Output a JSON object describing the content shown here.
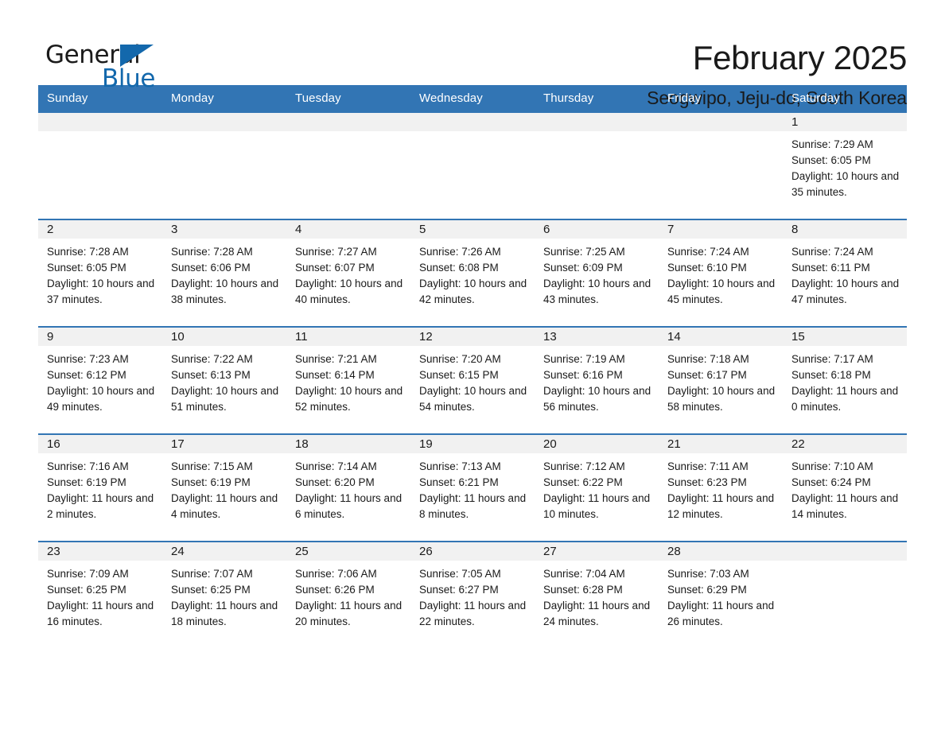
{
  "brand": {
    "name_part1": "General",
    "name_part2": "Blue",
    "triangle_color": "#1368ac",
    "accent_color": "#3275b4"
  },
  "header": {
    "title": "February 2025",
    "subtitle": "Seogwipo, Jeju-do, South Korea"
  },
  "weekday_headers": [
    "Sunday",
    "Monday",
    "Tuesday",
    "Wednesday",
    "Thursday",
    "Friday",
    "Saturday"
  ],
  "weeks": [
    [
      {
        "day": "",
        "sunrise": "",
        "sunset": "",
        "daylight": ""
      },
      {
        "day": "",
        "sunrise": "",
        "sunset": "",
        "daylight": ""
      },
      {
        "day": "",
        "sunrise": "",
        "sunset": "",
        "daylight": ""
      },
      {
        "day": "",
        "sunrise": "",
        "sunset": "",
        "daylight": ""
      },
      {
        "day": "",
        "sunrise": "",
        "sunset": "",
        "daylight": ""
      },
      {
        "day": "",
        "sunrise": "",
        "sunset": "",
        "daylight": ""
      },
      {
        "day": "1",
        "sunrise": "Sunrise: 7:29 AM",
        "sunset": "Sunset: 6:05 PM",
        "daylight": "Daylight: 10 hours and 35 minutes."
      }
    ],
    [
      {
        "day": "2",
        "sunrise": "Sunrise: 7:28 AM",
        "sunset": "Sunset: 6:05 PM",
        "daylight": "Daylight: 10 hours and 37 minutes."
      },
      {
        "day": "3",
        "sunrise": "Sunrise: 7:28 AM",
        "sunset": "Sunset: 6:06 PM",
        "daylight": "Daylight: 10 hours and 38 minutes."
      },
      {
        "day": "4",
        "sunrise": "Sunrise: 7:27 AM",
        "sunset": "Sunset: 6:07 PM",
        "daylight": "Daylight: 10 hours and 40 minutes."
      },
      {
        "day": "5",
        "sunrise": "Sunrise: 7:26 AM",
        "sunset": "Sunset: 6:08 PM",
        "daylight": "Daylight: 10 hours and 42 minutes."
      },
      {
        "day": "6",
        "sunrise": "Sunrise: 7:25 AM",
        "sunset": "Sunset: 6:09 PM",
        "daylight": "Daylight: 10 hours and 43 minutes."
      },
      {
        "day": "7",
        "sunrise": "Sunrise: 7:24 AM",
        "sunset": "Sunset: 6:10 PM",
        "daylight": "Daylight: 10 hours and 45 minutes."
      },
      {
        "day": "8",
        "sunrise": "Sunrise: 7:24 AM",
        "sunset": "Sunset: 6:11 PM",
        "daylight": "Daylight: 10 hours and 47 minutes."
      }
    ],
    [
      {
        "day": "9",
        "sunrise": "Sunrise: 7:23 AM",
        "sunset": "Sunset: 6:12 PM",
        "daylight": "Daylight: 10 hours and 49 minutes."
      },
      {
        "day": "10",
        "sunrise": "Sunrise: 7:22 AM",
        "sunset": "Sunset: 6:13 PM",
        "daylight": "Daylight: 10 hours and 51 minutes."
      },
      {
        "day": "11",
        "sunrise": "Sunrise: 7:21 AM",
        "sunset": "Sunset: 6:14 PM",
        "daylight": "Daylight: 10 hours and 52 minutes."
      },
      {
        "day": "12",
        "sunrise": "Sunrise: 7:20 AM",
        "sunset": "Sunset: 6:15 PM",
        "daylight": "Daylight: 10 hours and 54 minutes."
      },
      {
        "day": "13",
        "sunrise": "Sunrise: 7:19 AM",
        "sunset": "Sunset: 6:16 PM",
        "daylight": "Daylight: 10 hours and 56 minutes."
      },
      {
        "day": "14",
        "sunrise": "Sunrise: 7:18 AM",
        "sunset": "Sunset: 6:17 PM",
        "daylight": "Daylight: 10 hours and 58 minutes."
      },
      {
        "day": "15",
        "sunrise": "Sunrise: 7:17 AM",
        "sunset": "Sunset: 6:18 PM",
        "daylight": "Daylight: 11 hours and 0 minutes."
      }
    ],
    [
      {
        "day": "16",
        "sunrise": "Sunrise: 7:16 AM",
        "sunset": "Sunset: 6:19 PM",
        "daylight": "Daylight: 11 hours and 2 minutes."
      },
      {
        "day": "17",
        "sunrise": "Sunrise: 7:15 AM",
        "sunset": "Sunset: 6:19 PM",
        "daylight": "Daylight: 11 hours and 4 minutes."
      },
      {
        "day": "18",
        "sunrise": "Sunrise: 7:14 AM",
        "sunset": "Sunset: 6:20 PM",
        "daylight": "Daylight: 11 hours and 6 minutes."
      },
      {
        "day": "19",
        "sunrise": "Sunrise: 7:13 AM",
        "sunset": "Sunset: 6:21 PM",
        "daylight": "Daylight: 11 hours and 8 minutes."
      },
      {
        "day": "20",
        "sunrise": "Sunrise: 7:12 AM",
        "sunset": "Sunset: 6:22 PM",
        "daylight": "Daylight: 11 hours and 10 minutes."
      },
      {
        "day": "21",
        "sunrise": "Sunrise: 7:11 AM",
        "sunset": "Sunset: 6:23 PM",
        "daylight": "Daylight: 11 hours and 12 minutes."
      },
      {
        "day": "22",
        "sunrise": "Sunrise: 7:10 AM",
        "sunset": "Sunset: 6:24 PM",
        "daylight": "Daylight: 11 hours and 14 minutes."
      }
    ],
    [
      {
        "day": "23",
        "sunrise": "Sunrise: 7:09 AM",
        "sunset": "Sunset: 6:25 PM",
        "daylight": "Daylight: 11 hours and 16 minutes."
      },
      {
        "day": "24",
        "sunrise": "Sunrise: 7:07 AM",
        "sunset": "Sunset: 6:25 PM",
        "daylight": "Daylight: 11 hours and 18 minutes."
      },
      {
        "day": "25",
        "sunrise": "Sunrise: 7:06 AM",
        "sunset": "Sunset: 6:26 PM",
        "daylight": "Daylight: 11 hours and 20 minutes."
      },
      {
        "day": "26",
        "sunrise": "Sunrise: 7:05 AM",
        "sunset": "Sunset: 6:27 PM",
        "daylight": "Daylight: 11 hours and 22 minutes."
      },
      {
        "day": "27",
        "sunrise": "Sunrise: 7:04 AM",
        "sunset": "Sunset: 6:28 PM",
        "daylight": "Daylight: 11 hours and 24 minutes."
      },
      {
        "day": "28",
        "sunrise": "Sunrise: 7:03 AM",
        "sunset": "Sunset: 6:29 PM",
        "daylight": "Daylight: 11 hours and 26 minutes."
      },
      {
        "day": "",
        "sunrise": "",
        "sunset": "",
        "daylight": ""
      }
    ]
  ]
}
